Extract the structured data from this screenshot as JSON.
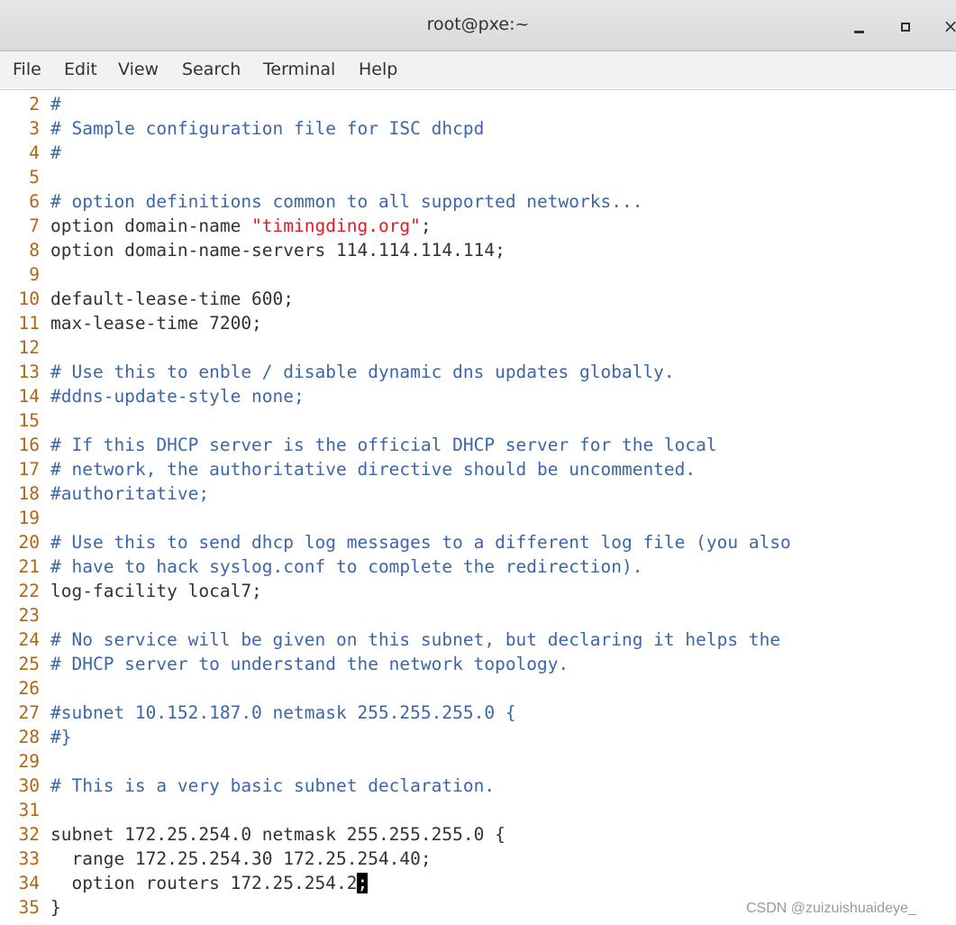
{
  "window": {
    "title": "root@pxe:~",
    "controls": {
      "minimize_icon": "minimize-icon",
      "maximize_icon": "maximize-icon",
      "close_icon": "close-icon",
      "close_glyph": "×"
    }
  },
  "menu": [
    "File",
    "Edit",
    "View",
    "Search",
    "Terminal",
    "Help"
  ],
  "editor": {
    "lines": [
      {
        "n": "2",
        "kind": "comment",
        "text": "#"
      },
      {
        "n": "3",
        "kind": "comment",
        "text": "# Sample configuration file for ISC dhcpd"
      },
      {
        "n": "4",
        "kind": "comment",
        "text": "#"
      },
      {
        "n": "5",
        "kind": "blank",
        "text": ""
      },
      {
        "n": "6",
        "kind": "comment",
        "text": "# option definitions common to all supported networks..."
      },
      {
        "n": "7",
        "kind": "string",
        "pre": "option domain-name ",
        "str": "\"timingding.org\"",
        "post": ";"
      },
      {
        "n": "8",
        "kind": "code",
        "text": "option domain-name-servers 114.114.114.114;"
      },
      {
        "n": "9",
        "kind": "blank",
        "text": ""
      },
      {
        "n": "10",
        "kind": "code",
        "text": "default-lease-time 600;"
      },
      {
        "n": "11",
        "kind": "code",
        "text": "max-lease-time 7200;"
      },
      {
        "n": "12",
        "kind": "blank",
        "text": ""
      },
      {
        "n": "13",
        "kind": "comment",
        "text": "# Use this to enble / disable dynamic dns updates globally."
      },
      {
        "n": "14",
        "kind": "comment",
        "text": "#ddns-update-style none;"
      },
      {
        "n": "15",
        "kind": "blank",
        "text": ""
      },
      {
        "n": "16",
        "kind": "comment",
        "text": "# If this DHCP server is the official DHCP server for the local"
      },
      {
        "n": "17",
        "kind": "comment",
        "text": "# network, the authoritative directive should be uncommented."
      },
      {
        "n": "18",
        "kind": "comment",
        "text": "#authoritative;"
      },
      {
        "n": "19",
        "kind": "blank",
        "text": ""
      },
      {
        "n": "20",
        "kind": "comment",
        "text": "# Use this to send dhcp log messages to a different log file (you also"
      },
      {
        "n": "21",
        "kind": "comment",
        "text": "# have to hack syslog.conf to complete the redirection)."
      },
      {
        "n": "22",
        "kind": "code",
        "text": "log-facility local7;"
      },
      {
        "n": "23",
        "kind": "blank",
        "text": ""
      },
      {
        "n": "24",
        "kind": "comment",
        "text": "# No service will be given on this subnet, but declaring it helps the"
      },
      {
        "n": "25",
        "kind": "comment",
        "text": "# DHCP server to understand the network topology."
      },
      {
        "n": "26",
        "kind": "blank",
        "text": ""
      },
      {
        "n": "27",
        "kind": "comment",
        "text": "#subnet 10.152.187.0 netmask 255.255.255.0 {"
      },
      {
        "n": "28",
        "kind": "comment",
        "text": "#}"
      },
      {
        "n": "29",
        "kind": "blank",
        "text": ""
      },
      {
        "n": "30",
        "kind": "comment",
        "text": "# This is a very basic subnet declaration."
      },
      {
        "n": "31",
        "kind": "blank",
        "text": ""
      },
      {
        "n": "32",
        "kind": "code",
        "text": "subnet 172.25.254.0 netmask 255.255.255.0 {"
      },
      {
        "n": "33",
        "kind": "code",
        "text": "  range 172.25.254.30 172.25.254.40;"
      },
      {
        "n": "34",
        "kind": "cursor",
        "pre": "  option routers 172.25.254.2",
        "cursor_char": ";"
      },
      {
        "n": "35",
        "kind": "code",
        "text": "}"
      }
    ]
  },
  "watermark": "CSDN @zuizuishuaideye_",
  "colors": {
    "comment": "#3b67a9",
    "line_number": "#b3650f",
    "string": "#e01b24",
    "text": "#2e3436"
  }
}
